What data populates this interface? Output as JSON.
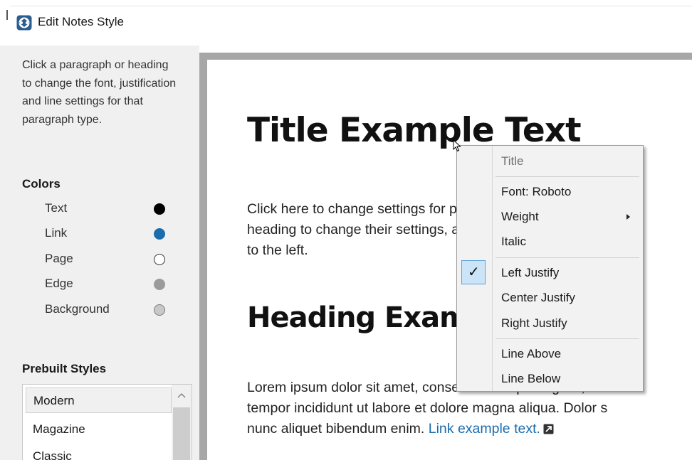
{
  "window": {
    "title": "Edit Notes Style",
    "icon": "app-logo-icon"
  },
  "sidebar": {
    "instructions": "Click a paragraph or heading to change the font, justification and line settings for that paragraph type.",
    "colors_title": "Colors",
    "colors": [
      {
        "label": "Text",
        "color": "#000000",
        "filled": true
      },
      {
        "label": "Link",
        "color": "#1a6cae",
        "filled": true
      },
      {
        "label": "Page",
        "color": "#ffffff",
        "filled": false
      },
      {
        "label": "Edge",
        "color": "#9b9b9b",
        "filled": true
      },
      {
        "label": "Background",
        "color": "#c8c8c8",
        "filled": true
      }
    ],
    "prebuilt_title": "Prebuilt Styles",
    "prebuilt": [
      "Modern",
      "Magazine",
      "Classic"
    ],
    "selected_style": "Modern"
  },
  "preview": {
    "title": "Title Example Text",
    "paragraph1_line1": "Click here to change settings for paragraphs. Click",
    "paragraph1_line2": "heading to change their settings, as specified u",
    "paragraph1_line3": "to the left.",
    "heading": "Heading Example",
    "paragraph2_line1": "Lorem ipsum dolor sit amet, consectetur adipiscing elit, se",
    "paragraph2_line2": "tempor incididunt ut labore et dolore magna aliqua. Dolor s",
    "paragraph2_line3": "nunc aliquet bibendum enim. ",
    "link_text": "Link example text."
  },
  "context_menu": {
    "header": "Title",
    "items": [
      {
        "label": "Font: Roboto"
      },
      {
        "label": "Weight",
        "submenu": true
      },
      {
        "label": "Italic"
      },
      {
        "label": "Left Justify",
        "checked": true
      },
      {
        "label": "Center Justify"
      },
      {
        "label": "Right Justify"
      },
      {
        "label": "Line Above"
      },
      {
        "label": "Line Below"
      }
    ]
  },
  "colors": {
    "sidebar_bg": "#f0f0f0",
    "frame_edge": "#a7a7a7",
    "link": "#1a6cae",
    "check_highlight": "#cce4f7"
  }
}
